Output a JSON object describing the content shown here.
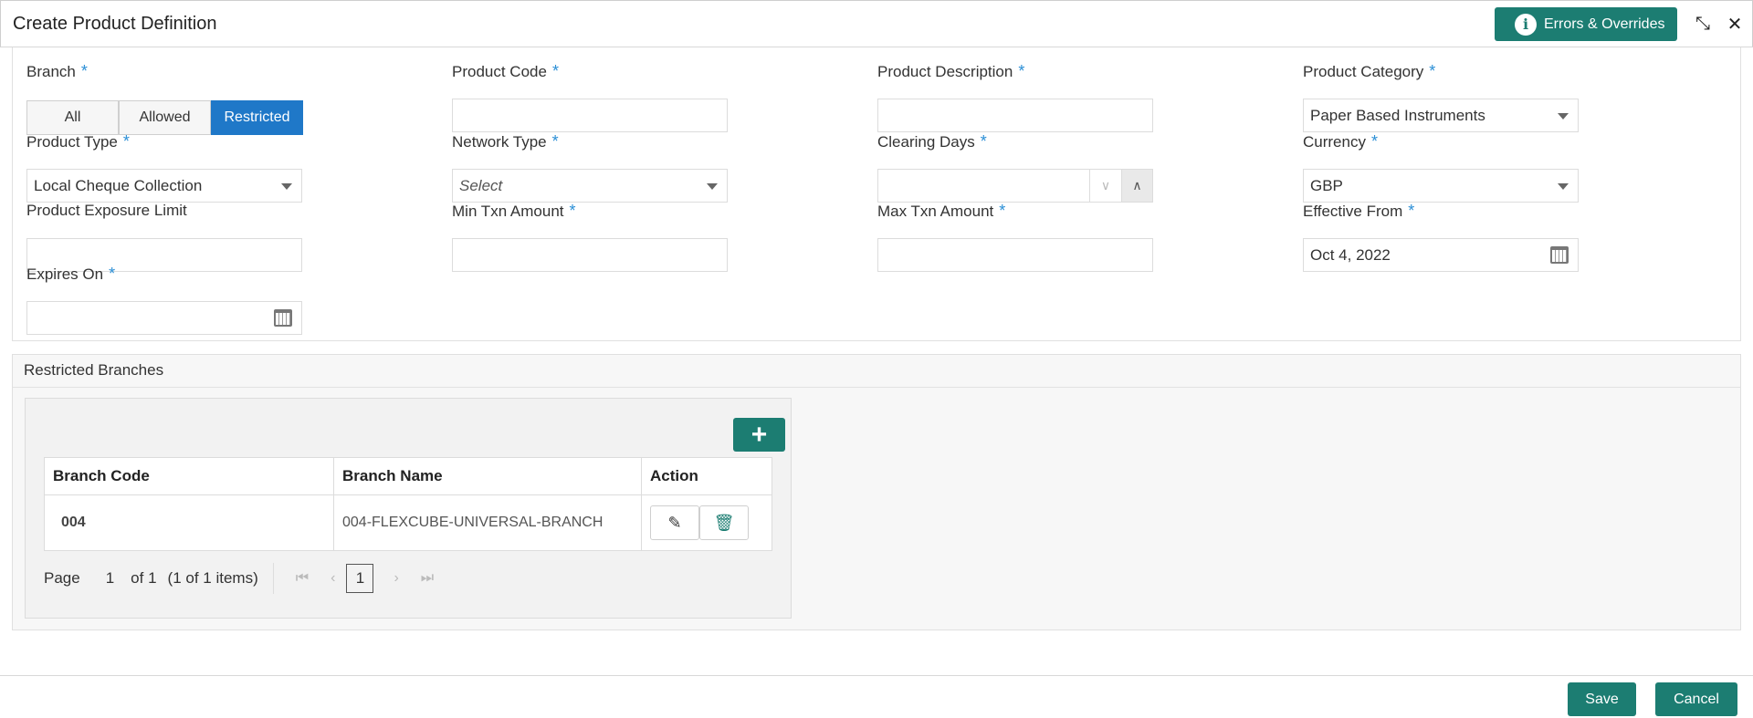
{
  "header": {
    "title": "Create Product Definition",
    "errors_button": "Errors & Overrides",
    "info_glyph": "i",
    "minimize_glyph": "⤡",
    "close_glyph": "✕"
  },
  "form": {
    "required_mark": "*",
    "branch": {
      "label": "Branch",
      "options": [
        "All",
        "Allowed",
        "Restricted"
      ],
      "selected": "Restricted"
    },
    "product_code": {
      "label": "Product Code",
      "value": ""
    },
    "product_description": {
      "label": "Product Description",
      "value": ""
    },
    "product_category": {
      "label": "Product Category",
      "value": "Paper Based Instruments"
    },
    "product_type": {
      "label": "Product Type",
      "value": "Local Cheque Collection"
    },
    "network_type": {
      "label": "Network Type",
      "placeholder": "Select"
    },
    "clearing_days": {
      "label": "Clearing Days",
      "value": ""
    },
    "currency": {
      "label": "Currency",
      "value": "GBP"
    },
    "product_exposure_limit": {
      "label": "Product Exposure Limit",
      "value": ""
    },
    "min_txn_amount": {
      "label": "Min Txn Amount",
      "value": ""
    },
    "max_txn_amount": {
      "label": "Max Txn Amount",
      "value": ""
    },
    "effective_from": {
      "label": "Effective From",
      "value": "Oct 4, 2022"
    },
    "expires_on": {
      "label": "Expires On",
      "value": ""
    }
  },
  "restricted_branches": {
    "title": "Restricted Branches",
    "add_glyph": "+",
    "columns": [
      "Branch Code",
      "Branch Name",
      "Action"
    ],
    "rows": [
      {
        "code": "004",
        "name": "004-FLEXCUBE-UNIVERSAL-BRANCH"
      }
    ],
    "edit_glyph": "✎",
    "delete_glyph": "🗑",
    "pager": {
      "page_label": "Page",
      "page": "1",
      "of_label": "of 1",
      "items_label": "(1 of 1 items)",
      "current_page": "1",
      "first_glyph": "⏮",
      "prev_glyph": "‹",
      "next_glyph": "›",
      "last_glyph": "⏭"
    }
  },
  "footer": {
    "save": "Save",
    "cancel": "Cancel"
  },
  "colors": {
    "primary": "#1c7d72",
    "selected": "#1f78c8",
    "required": "#2b8fd6"
  }
}
